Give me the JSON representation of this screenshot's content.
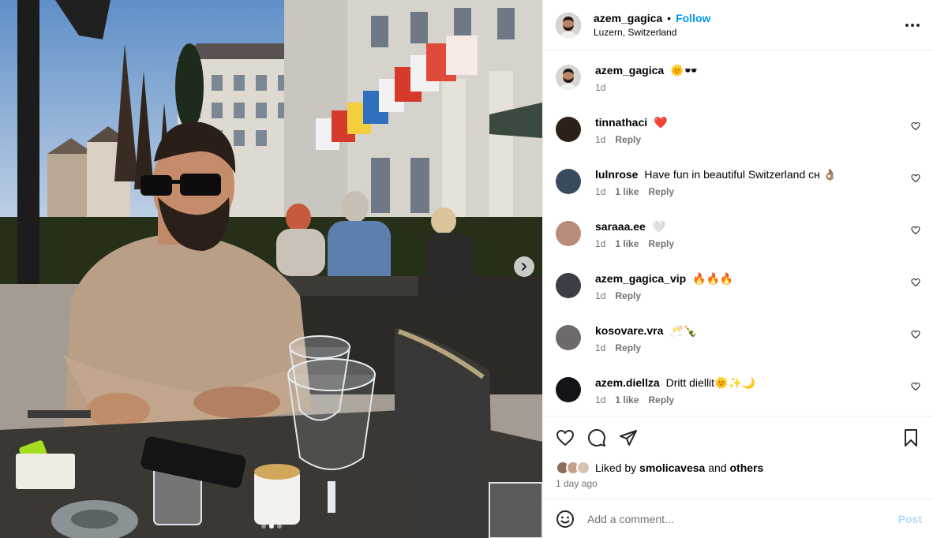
{
  "post": {
    "username": "azem_gagica",
    "separator": "•",
    "follow_label": "Follow",
    "location": "Luzern, Switzerland",
    "more_icon": "more-horizontal-icon"
  },
  "caption": {
    "username": "azem_gagica",
    "text": "🌞🕶️",
    "time": "1d"
  },
  "comments": [
    {
      "username": "tinnathaci",
      "text": "❤️",
      "time": "1d",
      "likes": "",
      "reply": "Reply",
      "avatar_color": "#2b2118"
    },
    {
      "username": "lulnrose",
      "text": "Have fun in beautiful Switzerland сн 👌🏽",
      "time": "1d",
      "likes": "1 like",
      "reply": "Reply",
      "avatar_color": "#3a4a5e"
    },
    {
      "username": "saraaa.ee",
      "text": "🤍",
      "time": "1d",
      "likes": "1 like",
      "reply": "Reply",
      "avatar_color": "#b98c7a"
    },
    {
      "username": "azem_gagica_vip",
      "text": "🔥🔥🔥",
      "time": "1d",
      "likes": "",
      "reply": "Reply",
      "avatar_color": "#3b3f45"
    },
    {
      "username": "kosovare.vra",
      "text": "🥂🍾",
      "time": "1d",
      "likes": "",
      "reply": "Reply",
      "avatar_color": "#6e6a6c"
    },
    {
      "username": "azem.diellza",
      "text": "Dritt diellit🌞✨🌙",
      "time": "1d",
      "likes": "1 like",
      "reply": "Reply",
      "avatar_color": "#141418"
    }
  ],
  "actions": {
    "like_icon": "heart-icon",
    "comment_icon": "comment-icon",
    "share_icon": "send-icon",
    "save_icon": "bookmark-icon"
  },
  "likes": {
    "prefix": "Liked by",
    "first_user": "smolicavesa",
    "connector": "and",
    "others": "others"
  },
  "time_ago": "1 day ago",
  "add_comment": {
    "placeholder": "Add a comment...",
    "post_label": "Post",
    "emoji_icon": "emoji-icon"
  },
  "carousel": {
    "next_icon": "chevron-right-icon",
    "total": 3,
    "active_index": 1
  },
  "colors": {
    "accent": "#0095f6",
    "post_disabled": "#b3dbff",
    "muted": "#737373",
    "border": "#efefef"
  }
}
